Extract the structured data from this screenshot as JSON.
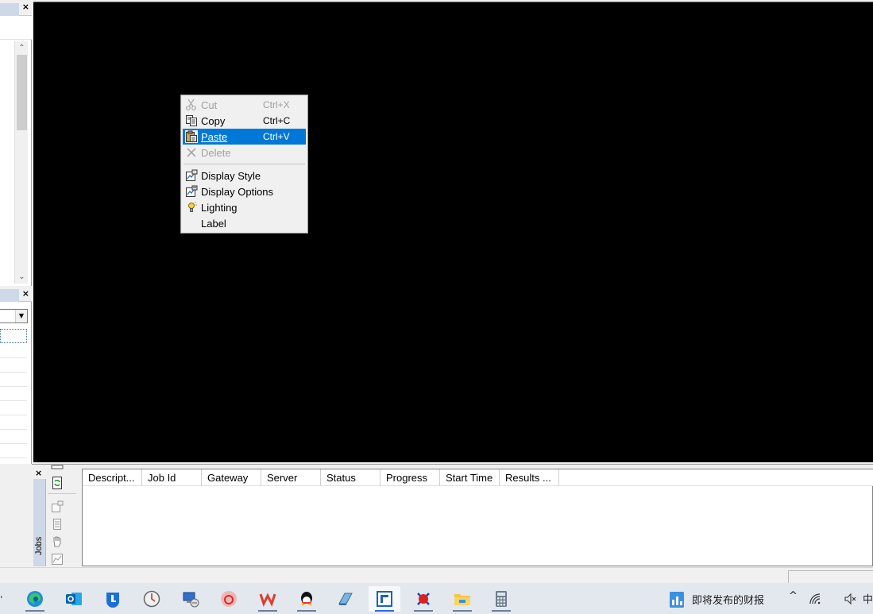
{
  "context_menu": {
    "items": [
      {
        "label": "Cut",
        "shortcut": "Ctrl+X",
        "icon": "scissors-icon",
        "enabled": false
      },
      {
        "label": "Copy",
        "shortcut": "Ctrl+C",
        "icon": "copy-icon",
        "enabled": true
      },
      {
        "label": "Paste",
        "shortcut": "Ctrl+V",
        "icon": "paste-icon",
        "enabled": true,
        "highlighted": true
      },
      {
        "label": "Delete",
        "shortcut": "",
        "icon": "delete-icon",
        "enabled": false
      },
      {
        "label": "Display Style",
        "icon": "display-style-icon",
        "enabled": true
      },
      {
        "label": "Display Options",
        "icon": "display-options-icon",
        "enabled": true
      },
      {
        "label": "Lighting",
        "icon": "lighting-icon",
        "enabled": true
      },
      {
        "label": "Label",
        "icon": "",
        "enabled": true
      }
    ]
  },
  "jobs": {
    "tab_label": "Jobs",
    "columns": [
      "Descript...",
      "Job Id",
      "Gateway",
      "Server",
      "Status",
      "Progress",
      "Start Time",
      "Results ..."
    ],
    "rows": []
  },
  "left_panes": {
    "close_symbol": "×"
  },
  "taskbar": {
    "apps": [
      "edge",
      "outlook",
      "lenovo-vantage",
      "clock-app",
      "remote-desktop",
      "netease-music",
      "wps-office",
      "qq",
      "eraser-app",
      "materials-studio",
      "molecule-app",
      "file-explorer",
      "calculator"
    ],
    "news_text": "即将发布的财报",
    "tray": {
      "ime": "中"
    }
  },
  "colors": {
    "viewport_bg": "#000000",
    "highlight": "#0078d7",
    "panel_tint": "#cdd9e6"
  }
}
